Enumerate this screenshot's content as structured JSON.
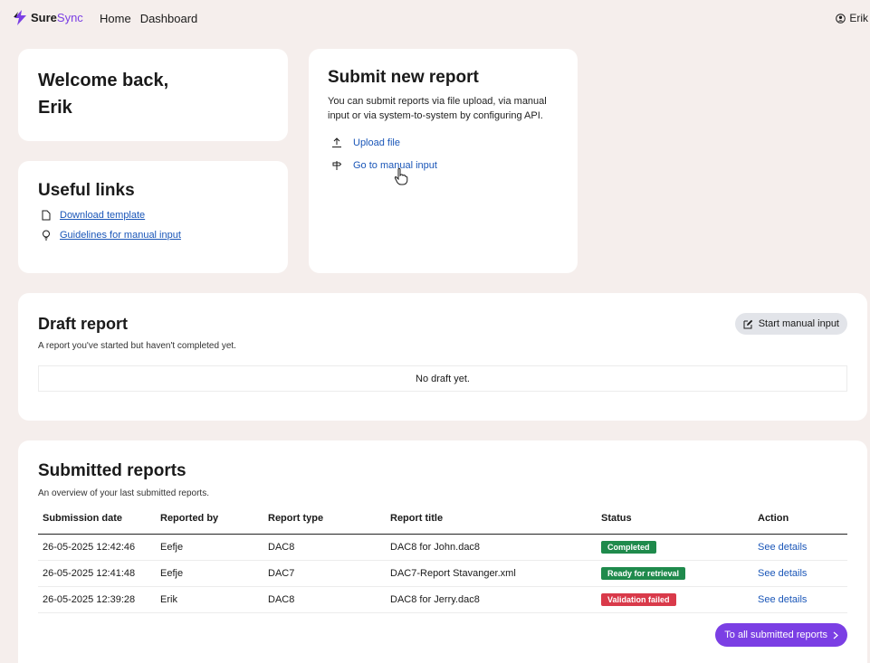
{
  "header": {
    "brand_sure": "Sure",
    "brand_sync": "Sync",
    "nav": [
      "Home",
      "Dashboard"
    ],
    "user_name": "Erik"
  },
  "welcome": {
    "line1": "Welcome back,",
    "line2": "Erik"
  },
  "useful_links": {
    "title": "Useful links",
    "items": [
      {
        "label": "Download template",
        "icon": "document-icon"
      },
      {
        "label": "Guidelines for manual input",
        "icon": "lightbulb-icon"
      }
    ]
  },
  "submit_report": {
    "title": "Submit new report",
    "description": "You can submit reports via file upload, via manual input or via system-to-system by configuring API.",
    "actions": [
      {
        "label": "Upload file",
        "icon": "upload-icon"
      },
      {
        "label": "Go to manual input",
        "icon": "signpost-icon"
      }
    ]
  },
  "draft": {
    "title": "Draft report",
    "subtitle": "A report you've started but haven't completed yet.",
    "button": "Start manual input",
    "empty": "No draft yet."
  },
  "submitted": {
    "title": "Submitted reports",
    "subtitle": "An overview of your last submitted reports.",
    "columns": [
      "Submission date",
      "Reported by",
      "Report type",
      "Report title",
      "Status",
      "Action"
    ],
    "rows": [
      {
        "date": "26-05-2025 12:42:46",
        "by": "Eefje",
        "type": "DAC8",
        "title": "DAC8 for John.dac8",
        "status": "Completed",
        "action": "See details"
      },
      {
        "date": "26-05-2025 12:41:48",
        "by": "Eefje",
        "type": "DAC7",
        "title": "DAC7-Report Stavanger.xml",
        "status": "Ready for retrieval",
        "action": "See details"
      },
      {
        "date": "26-05-2025 12:39:28",
        "by": "Erik",
        "type": "DAC8",
        "title": "DAC8 for Jerry.dac8",
        "status": "Validation failed",
        "action": "See details"
      }
    ],
    "button": "To all submitted reports"
  },
  "colors": {
    "accent": "#7b3fe4",
    "link": "#1a56b8",
    "completed": "#1f8a4c",
    "ready": "#1f8a4c",
    "failed": "#d93a4a"
  }
}
